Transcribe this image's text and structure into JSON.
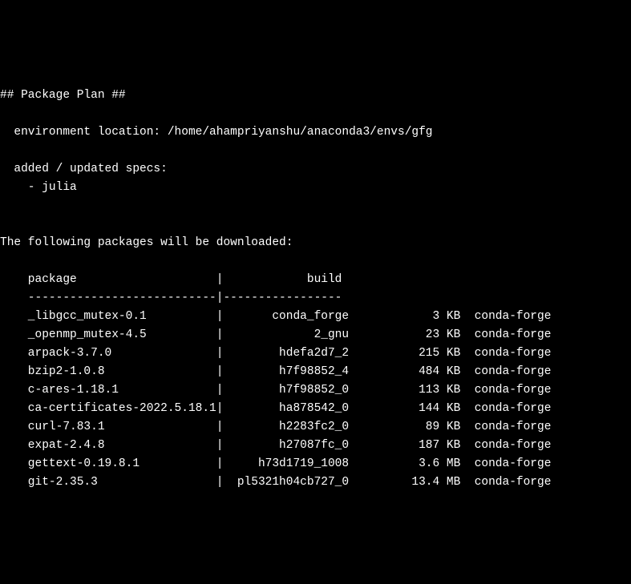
{
  "header": "## Package Plan ##",
  "env_label": "  environment location: ",
  "env_path": "/home/ahampriyanshu/anaconda3/envs/gfg",
  "specs_header": "  added / updated specs:",
  "specs": [
    "    - julia"
  ],
  "download_header": "The following packages will be downloaded:",
  "table_header_package": "    package                    |            build",
  "table_divider": "    ---------------------------|-----------------",
  "packages": [
    {
      "name": "_libgcc_mutex-0.1",
      "build": "conda_forge",
      "size": "3 KB",
      "channel": "conda-forge"
    },
    {
      "name": "_openmp_mutex-4.5",
      "build": "2_gnu",
      "size": "23 KB",
      "channel": "conda-forge"
    },
    {
      "name": "arpack-3.7.0",
      "build": "hdefa2d7_2",
      "size": "215 KB",
      "channel": "conda-forge"
    },
    {
      "name": "bzip2-1.0.8",
      "build": "h7f98852_4",
      "size": "484 KB",
      "channel": "conda-forge"
    },
    {
      "name": "c-ares-1.18.1",
      "build": "h7f98852_0",
      "size": "113 KB",
      "channel": "conda-forge"
    },
    {
      "name": "ca-certificates-2022.5.18.1",
      "build": "ha878542_0",
      "size": "144 KB",
      "channel": "conda-forge"
    },
    {
      "name": "curl-7.83.1",
      "build": "h2283fc2_0",
      "size": "89 KB",
      "channel": "conda-forge"
    },
    {
      "name": "expat-2.4.8",
      "build": "h27087fc_0",
      "size": "187 KB",
      "channel": "conda-forge"
    },
    {
      "name": "gettext-0.19.8.1",
      "build": "h73d1719_1008",
      "size": "3.6 MB",
      "channel": "conda-forge"
    },
    {
      "name": "git-2.35.3",
      "build": "pl5321h04cb727_0",
      "size": "13.4 MB",
      "channel": "conda-forge"
    }
  ]
}
